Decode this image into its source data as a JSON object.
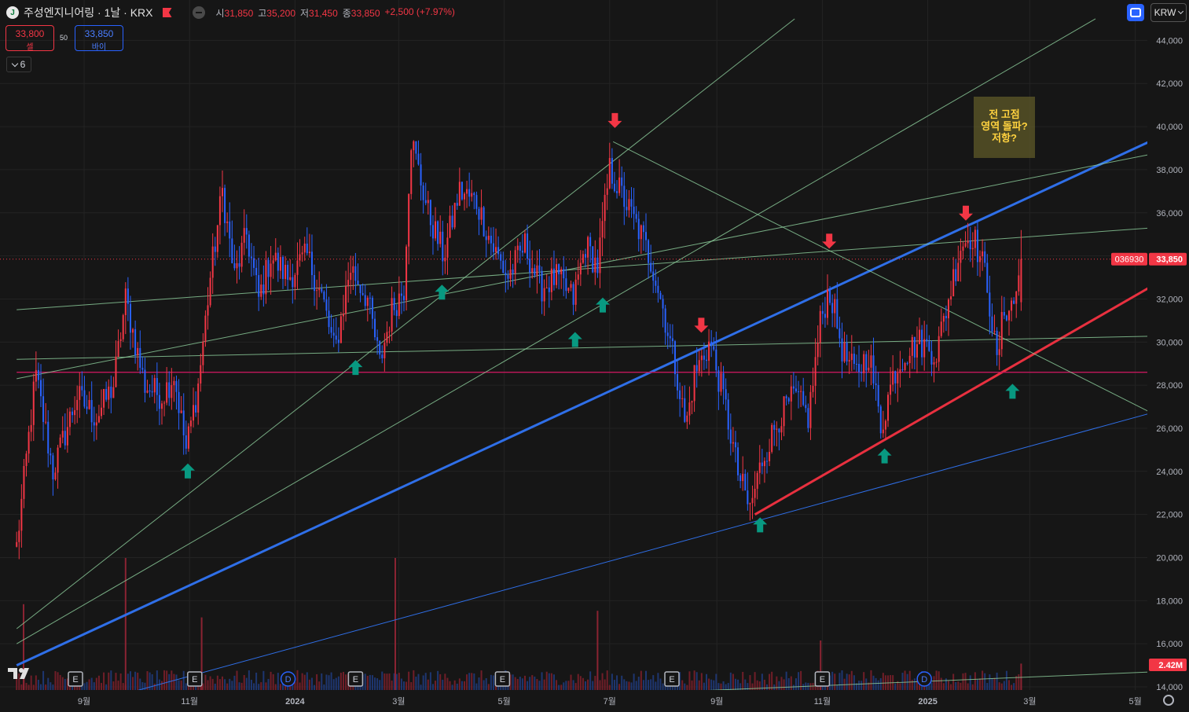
{
  "header": {
    "logo_text": "J",
    "title": "주성엔지니어링 · 1날 · KRX",
    "ohlc": [
      {
        "k": "시",
        "v": "31,850"
      },
      {
        "k": "고",
        "v": "35,200"
      },
      {
        "k": "저",
        "v": "31,450"
      },
      {
        "k": "종",
        "v": "33,850"
      },
      {
        "k": "",
        "v": "+2,500 (+7.97%)"
      }
    ]
  },
  "trade": {
    "sell_price": "33,800",
    "sell_label": "셀",
    "spread": "50",
    "buy_price": "33,850",
    "buy_label": "바이"
  },
  "indicators_collapsed": "6",
  "currency": "KRW",
  "note": {
    "line1": "전 고점",
    "line2": "영역 돌파?",
    "line3": "저항?"
  },
  "colors": {
    "up": "#f23645",
    "down": "#2962ff",
    "blue_line": "#2f6fe8",
    "red_line": "#e8303f",
    "thin_green": "#8fd19e",
    "magenta": "#c2185b",
    "green_arrow": "#089981",
    "red_arrow": "#f23645"
  },
  "chart_data": {
    "type": "candlestick",
    "symbol": "036930",
    "last_price": 33850,
    "last_price_label": "33,850",
    "volume_label": "2.42M",
    "ylim": [
      14000,
      45000
    ],
    "y_ticks": [
      "44,000",
      "42,000",
      "40,000",
      "38,000",
      "36,000",
      "34,000",
      "32,000",
      "30,000",
      "28,000",
      "26,000",
      "24,000",
      "22,000",
      "20,000",
      "18,000",
      "16,000",
      "14,000"
    ],
    "x_ticks": [
      {
        "label": "9월",
        "date": "2023-09-01"
      },
      {
        "label": "11월",
        "date": "2023-11-01"
      },
      {
        "label": "2024",
        "date": "2024-01-01"
      },
      {
        "label": "3월",
        "date": "2024-03-01"
      },
      {
        "label": "5월",
        "date": "2024-05-01"
      },
      {
        "label": "7월",
        "date": "2024-07-01"
      },
      {
        "label": "9월",
        "date": "2024-09-01"
      },
      {
        "label": "11월",
        "date": "2024-11-01"
      },
      {
        "label": "2025",
        "date": "2025-01-01"
      },
      {
        "label": "3월",
        "date": "2025-03-01"
      },
      {
        "label": "5월",
        "date": "2025-05-01"
      }
    ],
    "price_path": [
      [
        "2023-07-24",
        20500
      ],
      [
        "2023-08-04",
        28500
      ],
      [
        "2023-08-14",
        24000
      ],
      [
        "2023-08-28",
        27500
      ],
      [
        "2023-09-08",
        26500
      ],
      [
        "2023-09-18",
        28000
      ],
      [
        "2023-09-25",
        32000
      ],
      [
        "2023-10-06",
        28000
      ],
      [
        "2023-10-16",
        27500
      ],
      [
        "2023-10-23",
        28500
      ],
      [
        "2023-10-30",
        25000
      ],
      [
        "2023-11-06",
        28000
      ],
      [
        "2023-11-13",
        33000
      ],
      [
        "2023-11-20",
        37000
      ],
      [
        "2023-11-27",
        33000
      ],
      [
        "2023-12-04",
        35000
      ],
      [
        "2023-12-11",
        32000
      ],
      [
        "2023-12-18",
        34000
      ],
      [
        "2023-12-28",
        33000
      ],
      [
        "2024-01-08",
        34000
      ],
      [
        "2024-01-17",
        32000
      ],
      [
        "2024-01-24",
        29500
      ],
      [
        "2024-02-02",
        33500
      ],
      [
        "2024-02-12",
        32000
      ],
      [
        "2024-02-19",
        29000
      ],
      [
        "2024-02-26",
        31500
      ],
      [
        "2024-03-04",
        32500
      ],
      [
        "2024-03-08",
        39500
      ],
      [
        "2024-03-18",
        36000
      ],
      [
        "2024-03-27",
        34000
      ],
      [
        "2024-04-05",
        37000
      ],
      [
        "2024-04-15",
        36500
      ],
      [
        "2024-04-24",
        34500
      ],
      [
        "2024-05-03",
        33000
      ],
      [
        "2024-05-13",
        34500
      ],
      [
        "2024-05-22",
        32500
      ],
      [
        "2024-05-31",
        33000
      ],
      [
        "2024-06-10",
        32000
      ],
      [
        "2024-06-17",
        34500
      ],
      [
        "2024-06-24",
        33500
      ],
      [
        "2024-07-01",
        38000
      ],
      [
        "2024-07-10",
        36500
      ],
      [
        "2024-07-19",
        35000
      ],
      [
        "2024-07-26",
        33500
      ],
      [
        "2024-08-01",
        31500
      ],
      [
        "2024-08-09",
        28500
      ],
      [
        "2024-08-14",
        26000
      ],
      [
        "2024-08-19",
        28500
      ],
      [
        "2024-08-28",
        30000
      ],
      [
        "2024-09-06",
        27000
      ],
      [
        "2024-09-13",
        24000
      ],
      [
        "2024-09-20",
        22200
      ],
      [
        "2024-09-27",
        24500
      ],
      [
        "2024-10-07",
        26500
      ],
      [
        "2024-10-16",
        27500
      ],
      [
        "2024-10-24",
        26500
      ],
      [
        "2024-10-31",
        31000
      ],
      [
        "2024-11-05",
        32500
      ],
      [
        "2024-11-13",
        29500
      ],
      [
        "2024-11-20",
        28500
      ],
      [
        "2024-11-28",
        29500
      ],
      [
        "2024-12-05",
        26000
      ],
      [
        "2024-12-12",
        28500
      ],
      [
        "2024-12-19",
        29500
      ],
      [
        "2024-12-27",
        30000
      ],
      [
        "2025-01-06",
        29500
      ],
      [
        "2025-01-13",
        32000
      ],
      [
        "2025-01-20",
        34500
      ],
      [
        "2025-01-27",
        35000
      ],
      [
        "2025-02-04",
        33000
      ],
      [
        "2025-02-10",
        29000
      ],
      [
        "2025-02-14",
        31500
      ],
      [
        "2025-02-20",
        31800
      ],
      [
        "2025-02-24",
        33850
      ]
    ],
    "trendlines": [
      {
        "color": "blue",
        "width": "thick",
        "from": [
          "2023-07-24",
          15000
        ],
        "to": [
          "2025-05-28",
          40000
        ]
      },
      {
        "color": "blue",
        "width": "thin",
        "from": [
          "2023-07-24",
          12300
        ],
        "to": [
          "2025-05-28",
          27100
        ]
      },
      {
        "color": "red",
        "width": "thick",
        "from": [
          "2024-09-23",
          22000
        ],
        "to": [
          "2025-05-28",
          33400
        ]
      },
      {
        "color": "magenta",
        "width": "thin",
        "from": [
          "2023-07-24",
          28600
        ],
        "to": [
          "2025-05-28",
          28600
        ]
      },
      {
        "color": "green",
        "width": "thin",
        "from": [
          "2023-07-24",
          29200
        ],
        "to": [
          "2025-05-28",
          30300
        ]
      },
      {
        "color": "green",
        "width": "thin",
        "from": [
          "2023-07-24",
          31500
        ],
        "to": [
          "2025-05-28",
          35400
        ]
      },
      {
        "color": "green",
        "width": "thin",
        "from": [
          "2023-07-24",
          28300
        ],
        "to": [
          "2025-05-28",
          39000
        ]
      },
      {
        "color": "green",
        "width": "thin",
        "from": [
          "2023-07-24",
          16700
        ],
        "to": [
          "2024-10-16",
          45000
        ]
      },
      {
        "color": "green",
        "width": "thin",
        "from": [
          "2023-07-24",
          16000
        ],
        "to": [
          "2025-04-08",
          45000
        ]
      },
      {
        "color": "green",
        "width": "thin",
        "from": [
          "2024-07-03",
          39300
        ],
        "to": [
          "2025-05-28",
          26000
        ]
      },
      {
        "color": "green",
        "width": "thin",
        "from": [
          "2023-07-24",
          12500
        ],
        "to": [
          "2025-05-28",
          14750
        ]
      }
    ],
    "arrows": [
      {
        "dir": "up",
        "date": "2023-10-31",
        "price": 24000
      },
      {
        "dir": "up",
        "date": "2024-02-05",
        "price": 28800
      },
      {
        "dir": "up",
        "date": "2024-03-26",
        "price": 32300
      },
      {
        "dir": "up",
        "date": "2024-06-11",
        "price": 30100
      },
      {
        "dir": "up",
        "date": "2024-06-27",
        "price": 31700
      },
      {
        "dir": "down",
        "date": "2024-07-04",
        "price": 40300
      },
      {
        "dir": "down",
        "date": "2024-08-23",
        "price": 30800
      },
      {
        "dir": "up",
        "date": "2024-09-26",
        "price": 21500
      },
      {
        "dir": "down",
        "date": "2024-11-05",
        "price": 34700
      },
      {
        "dir": "up",
        "date": "2024-12-07",
        "price": 24700
      },
      {
        "dir": "down",
        "date": "2025-01-23",
        "price": 36000
      },
      {
        "dir": "up",
        "date": "2025-02-19",
        "price": 27700
      }
    ],
    "event_markers": [
      {
        "type": "E",
        "date": "2023-08-27"
      },
      {
        "type": "E",
        "date": "2023-11-04"
      },
      {
        "type": "D",
        "date": "2023-12-28"
      },
      {
        "type": "E",
        "date": "2024-02-05"
      },
      {
        "type": "E",
        "date": "2024-04-30"
      },
      {
        "type": "E",
        "date": "2024-08-06"
      },
      {
        "type": "E",
        "date": "2024-11-01"
      },
      {
        "type": "D",
        "date": "2024-12-30"
      }
    ],
    "volume_spikes": [
      {
        "date": "2023-07-28",
        "millions": 2.6
      },
      {
        "date": "2023-09-25",
        "millions": 4.0
      },
      {
        "date": "2023-11-08",
        "millions": 2.2
      },
      {
        "date": "2024-02-28",
        "millions": 4.0
      },
      {
        "date": "2024-06-24",
        "millions": 2.4
      },
      {
        "date": "2024-10-31",
        "millions": 1.5
      },
      {
        "date": "2025-02-24",
        "millions": 0.8
      }
    ]
  }
}
